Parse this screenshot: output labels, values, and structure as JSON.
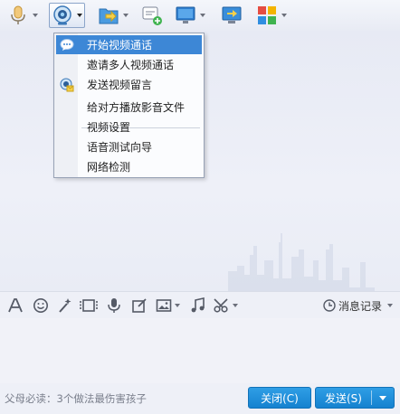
{
  "toolbar": {
    "buttons": [
      {
        "name": "voice-call",
        "icon": "microphone-icon"
      },
      {
        "name": "video-call",
        "icon": "webcam-icon",
        "active": true
      },
      {
        "name": "send-file",
        "icon": "folder-send-icon"
      },
      {
        "name": "create-discussion",
        "icon": "add-group-chat-icon"
      },
      {
        "name": "remote-desktop",
        "icon": "monitor-icon"
      },
      {
        "name": "share-screen",
        "icon": "screen-share-icon"
      },
      {
        "name": "apps",
        "icon": "apps-grid-icon"
      }
    ]
  },
  "video_menu": {
    "items": [
      {
        "label": "开始视频通话",
        "icon": "video-chat-bubble-icon",
        "highlighted": true
      },
      {
        "label": "邀请多人视频通话"
      },
      {
        "label": "发送视频留言",
        "icon": "video-message-icon"
      },
      {
        "label": "给对方播放影音文件"
      },
      {
        "label": "视频设置"
      },
      {
        "label": "语音测试向导"
      },
      {
        "label": "网络检测"
      }
    ]
  },
  "input_toolbar": {
    "tools": [
      "font-icon",
      "emoji-icon",
      "magic-wand-icon",
      "video-clip-icon",
      "voice-message-icon",
      "edit-note-icon",
      "image-icon",
      "music-icon",
      "screenshot-scissors-icon"
    ],
    "history_label": "消息记录"
  },
  "input": {
    "value": "",
    "placeholder": ""
  },
  "footer": {
    "ad_text": "父母必读：3个做法最伤害孩子",
    "close_label": "关闭(C)",
    "send_label": "发送(S)"
  },
  "colors": {
    "accent": "#1a8ad6",
    "menu_highlight": "#3d87d6",
    "background": "#eef0f7"
  }
}
